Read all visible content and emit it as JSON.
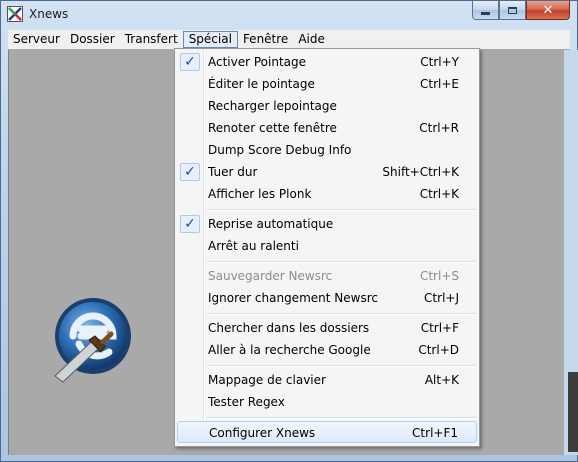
{
  "window": {
    "title": "Xnews",
    "close_glyph": "✕"
  },
  "menubar": {
    "items": [
      "Serveur",
      "Dossier",
      "Transfert",
      "Spécial",
      "Fenêtre",
      "Aide"
    ],
    "active": "Spécial"
  },
  "dropdown": {
    "items": [
      {
        "label": "Activer Pointage",
        "shortcut": "Ctrl+Y",
        "checked": true
      },
      {
        "label": "Éditer le pointage",
        "shortcut": "Ctrl+E"
      },
      {
        "label": "Recharger lepointage",
        "shortcut": ""
      },
      {
        "label": "Renoter cette fenêtre",
        "shortcut": "Ctrl+R"
      },
      {
        "label": "Dump Score Debug Info",
        "shortcut": ""
      },
      {
        "label": "Tuer dur",
        "shortcut": "Shift+Ctrl+K",
        "checked": true
      },
      {
        "label": "Afficher les Plonk",
        "shortcut": "Ctrl+K"
      },
      {
        "label": "Reprise automatique",
        "shortcut": "",
        "checked": true
      },
      {
        "label": "Arrêt au ralenti",
        "shortcut": ""
      },
      {
        "label": "Sauvegarder Newsrc",
        "shortcut": "Ctrl+S",
        "disabled": true
      },
      {
        "label": "Ignorer changement Newsrc",
        "shortcut": "Ctrl+J"
      },
      {
        "label": "Chercher dans les dossiers",
        "shortcut": "Ctrl+F"
      },
      {
        "label": "Aller à la recherche Google",
        "shortcut": "Ctrl+D"
      },
      {
        "label": "Mappage de clavier",
        "shortcut": "Alt+K"
      },
      {
        "label": "Tester Regex",
        "shortcut": ""
      },
      {
        "label": "Configurer Xnews",
        "shortcut": "Ctrl+F1",
        "highlighted": true
      }
    ],
    "check_glyph": "✓"
  },
  "colors": {
    "client_bg": "#a9a9a9",
    "menu_bg": "#f5f5f5",
    "highlight": "#dde9f8",
    "check": "#1e4a9a"
  }
}
